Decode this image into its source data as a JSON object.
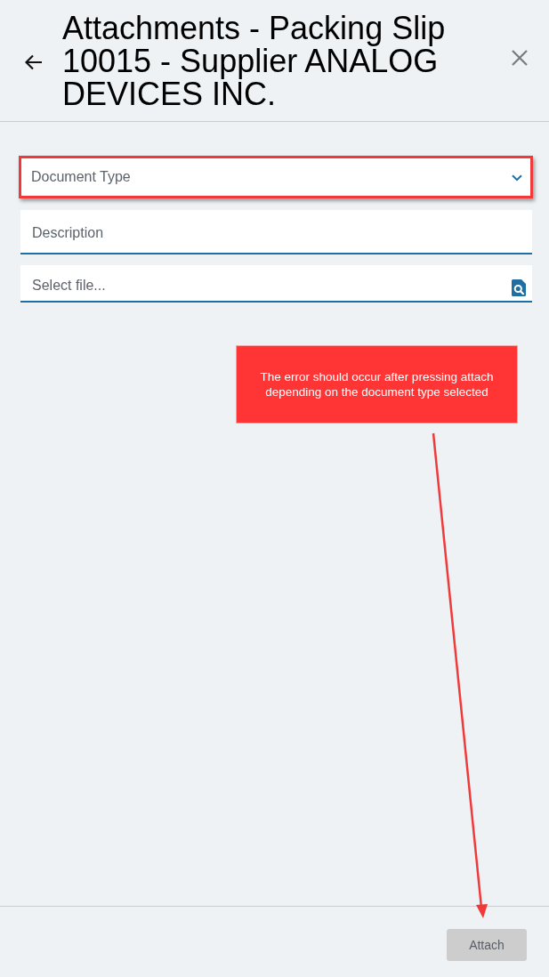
{
  "header": {
    "title": "Attachments - Packing Slip 10015 - Supplier ANALOG DEVICES INC."
  },
  "fields": [
    {
      "kind": "dropdown",
      "placeholder": "Document Type",
      "highlighted": true
    },
    {
      "kind": "text",
      "placeholder": "Description",
      "highlighted": false
    },
    {
      "kind": "file",
      "placeholder": "Select file...",
      "highlighted": false
    }
  ],
  "annotation": {
    "text": "The error should occur after pressing attach depending on the document type selected"
  },
  "footer": {
    "button": {
      "label": "Attach",
      "disabled": true
    }
  }
}
